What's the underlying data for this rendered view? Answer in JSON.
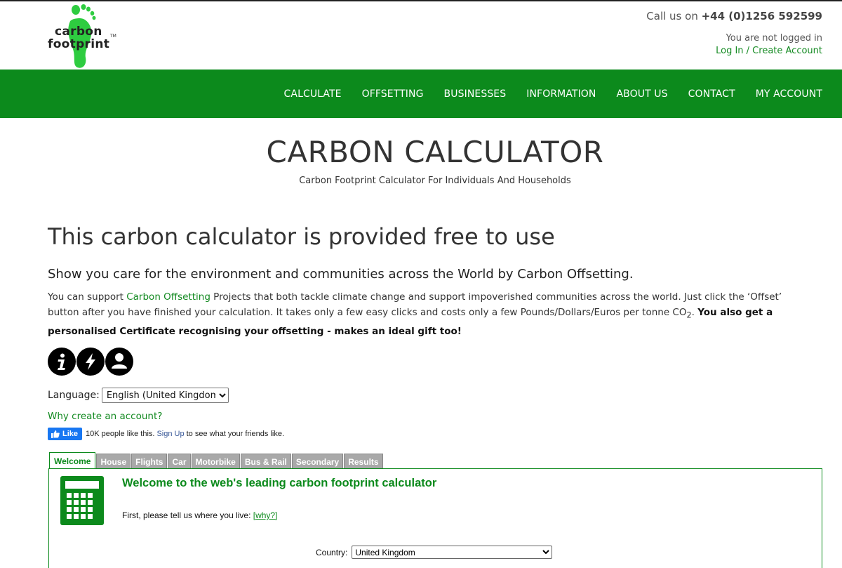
{
  "header": {
    "logo_line1": "carbon",
    "logo_line2": "footprint",
    "logo_tm": "TM",
    "call_prefix": "Call us on ",
    "call_number": "+44 (0)1256 592599",
    "not_logged_in": "You are not logged in",
    "login_link": "Log In / Create Account"
  },
  "nav": {
    "items": [
      "CALCULATE",
      "OFFSETTING",
      "BUSINESSES",
      "INFORMATION",
      "ABOUT US",
      "CONTACT",
      "MY ACCOUNT"
    ]
  },
  "page": {
    "title": "CARBON CALCULATOR",
    "subtitle": "Carbon Footprint Calculator For Individuals And Households",
    "heading": "This carbon calculator is provided free to use",
    "subheading": "Show you care for the environment and communities across the World by Carbon Offsetting.",
    "para_1": "You can support ",
    "para_link": "Carbon Offsetting",
    "para_2": " Projects that both tackle climate change and support impoverished communities across the world. Just click the ‘Offset’ button after you have finished your calculation. It takes only a few easy clicks and costs only a few Pounds/Dollars/Euros per tonne CO",
    "para_sub": "2",
    "para_3": ". ",
    "para_bold": "You also get a personalised Certificate recognising your offsetting - makes an ideal gift too!"
  },
  "icons": [
    "info-icon",
    "lightning-icon",
    "user-icon"
  ],
  "language": {
    "label": "Language:",
    "selected": "English (United Kingdom)"
  },
  "why_account": "Why create an account?",
  "facebook": {
    "like": "Like",
    "text_1": "10K people like this.",
    "signup": "Sign Up",
    "text_2": "to see what your friends like."
  },
  "tabs": [
    "Welcome",
    "House",
    "Flights",
    "Car",
    "Motorbike",
    "Bus & Rail",
    "Secondary",
    "Results"
  ],
  "active_tab": "Welcome",
  "panel": {
    "title": "Welcome to the web's leading carbon footprint calculator",
    "ask": "First, please tell us where you live: ",
    "why_link": "[why?]",
    "country_label": "Country:",
    "country_selected": "United Kingdom"
  },
  "colors": {
    "brand_green": "#0c8a1c",
    "link_green": "#138a21",
    "logo_green": "#2ecc40"
  }
}
